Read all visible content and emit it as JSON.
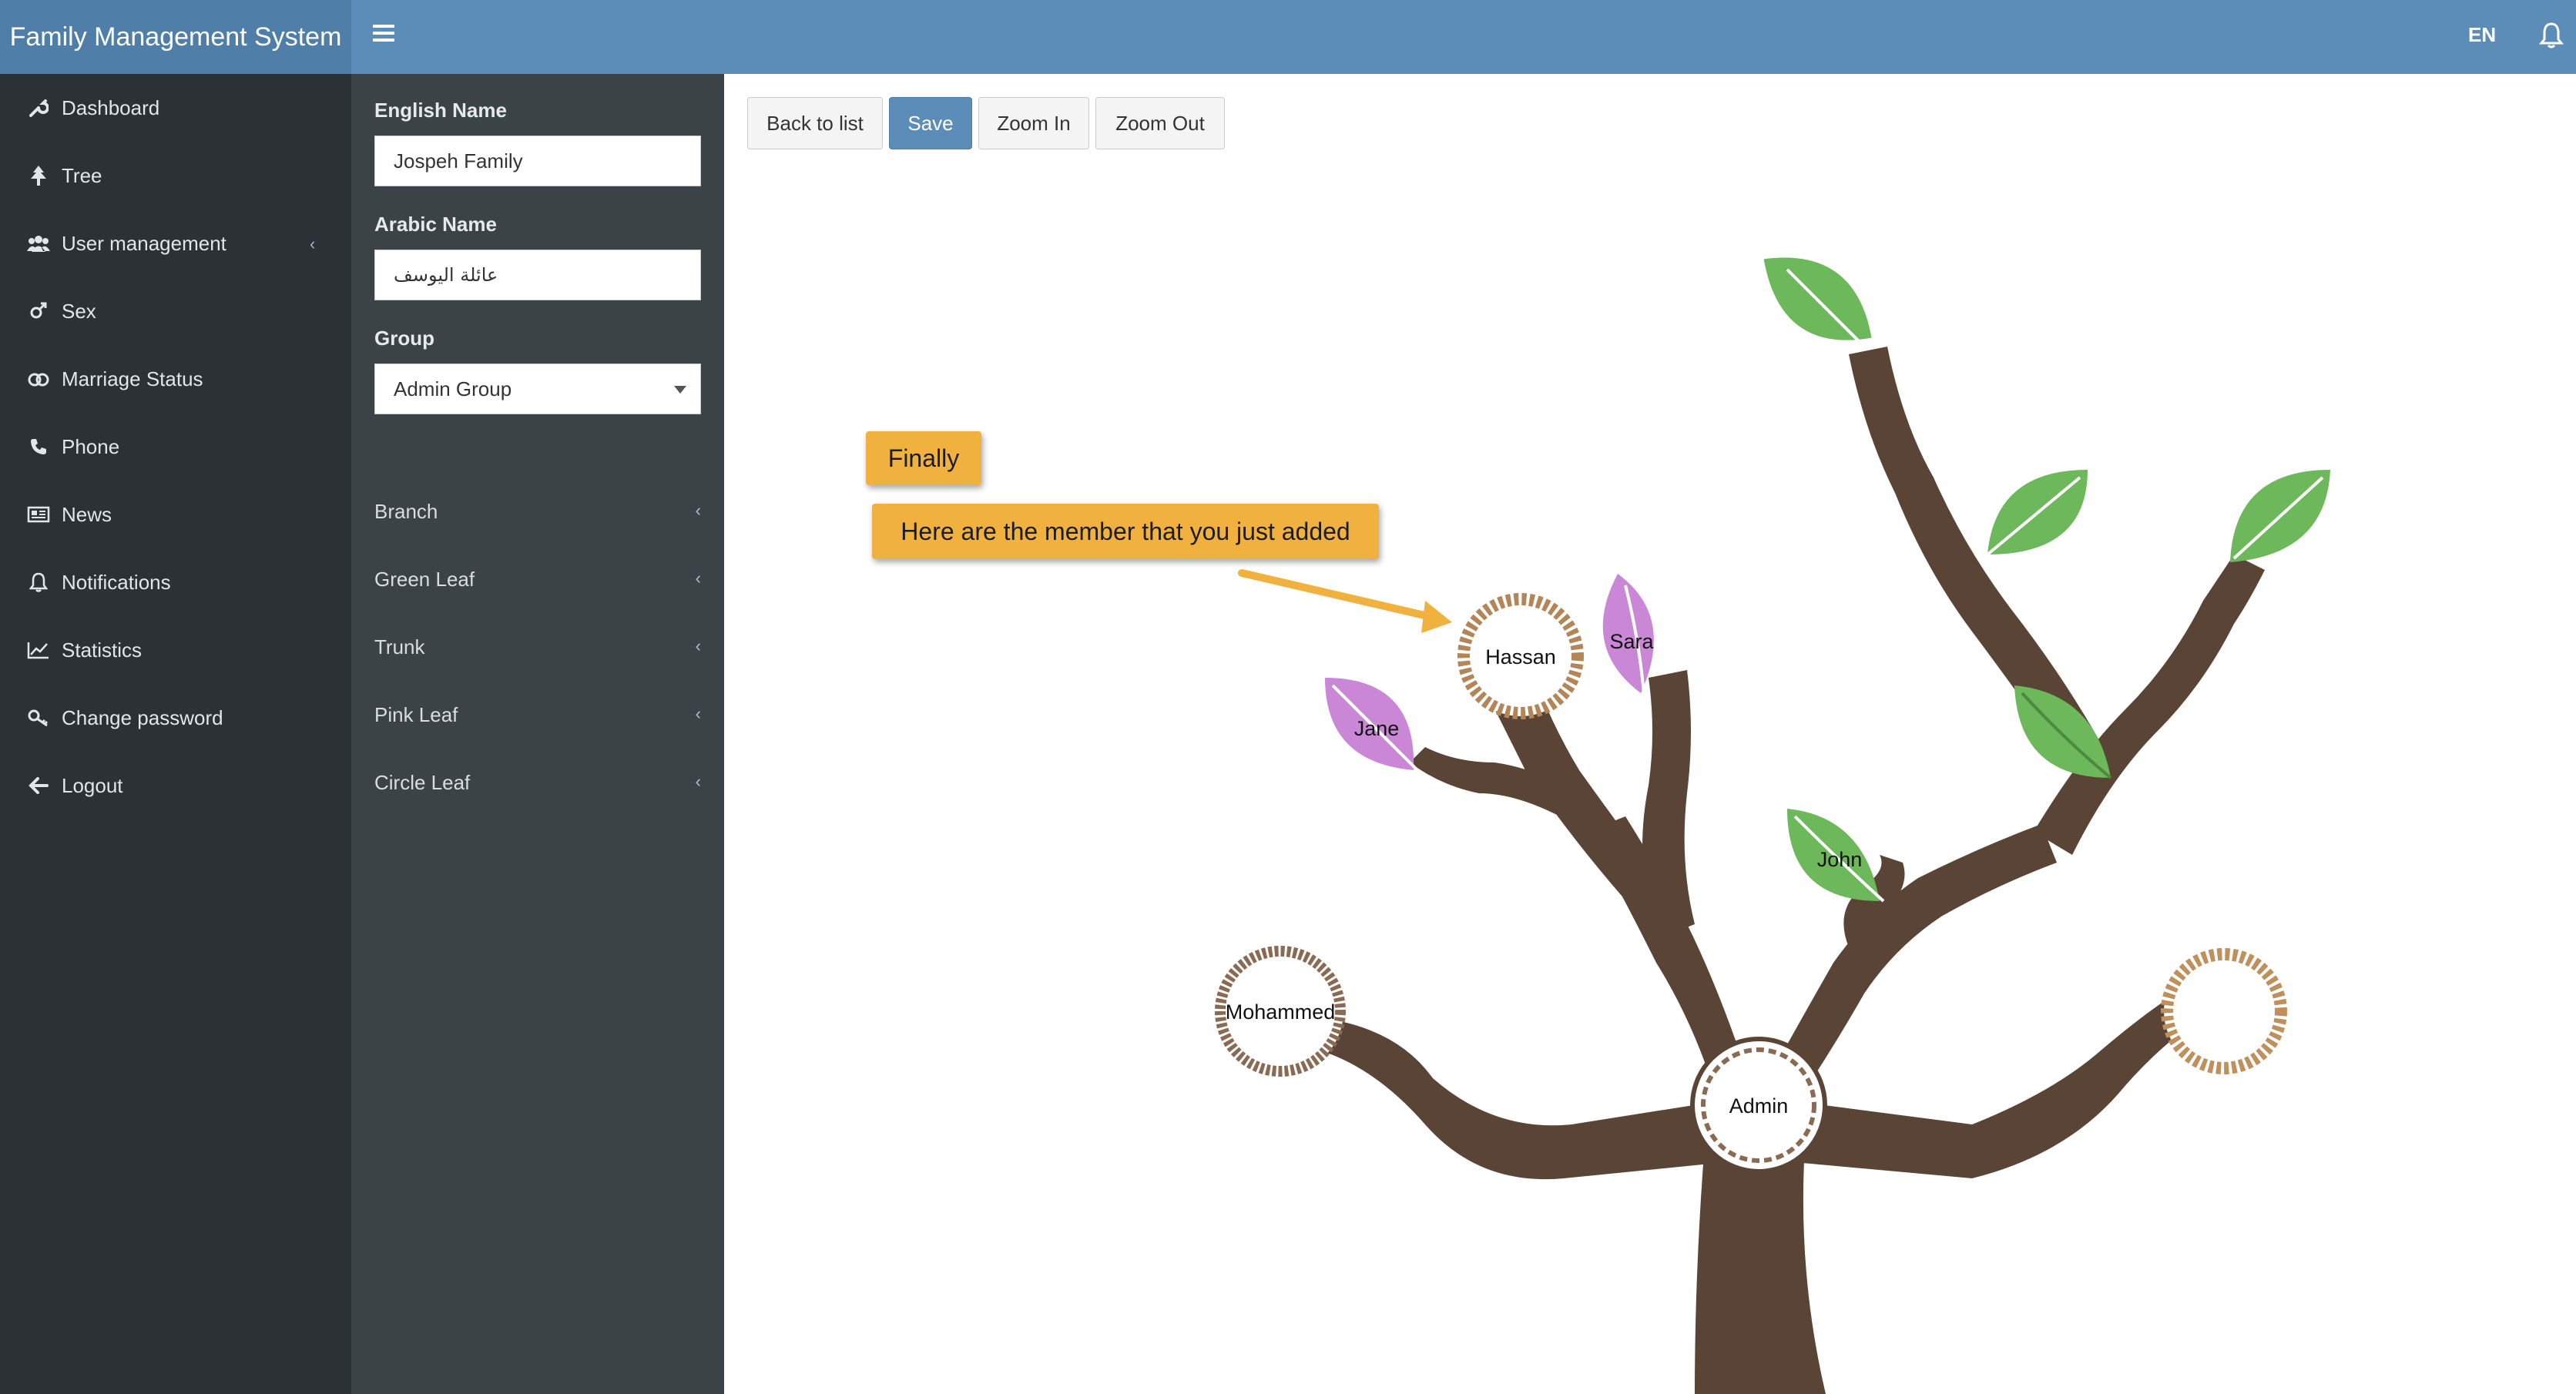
{
  "app": {
    "title": "Family Management System",
    "language": "EN"
  },
  "sidebar": {
    "items": [
      {
        "label": "Dashboard",
        "icon": "wrench-icon"
      },
      {
        "label": "Tree",
        "icon": "tree-icon"
      },
      {
        "label": "User management",
        "icon": "users-icon",
        "has_submenu": true
      },
      {
        "label": "Sex",
        "icon": "gender-icon"
      },
      {
        "label": "Marriage Status",
        "icon": "rings-icon"
      },
      {
        "label": "Phone",
        "icon": "phone-icon"
      },
      {
        "label": "News",
        "icon": "newspaper-icon"
      },
      {
        "label": "Notifications",
        "icon": "bell-icon"
      },
      {
        "label": "Statistics",
        "icon": "chart-icon"
      },
      {
        "label": "Change password",
        "icon": "key-icon"
      },
      {
        "label": "Logout",
        "icon": "arrow-left-icon"
      }
    ]
  },
  "form": {
    "english_name": {
      "label": "English Name",
      "value": "Jospeh Family"
    },
    "arabic_name": {
      "label": "Arabic Name",
      "value": "عائلة اليوسف"
    },
    "group": {
      "label": "Group",
      "value": "Admin Group"
    }
  },
  "categories": [
    {
      "label": "Branch"
    },
    {
      "label": "Green Leaf"
    },
    {
      "label": "Trunk"
    },
    {
      "label": "Pink Leaf"
    },
    {
      "label": "Circle Leaf"
    }
  ],
  "toolbar": {
    "back": "Back to list",
    "save": "Save",
    "zoom_in": "Zoom In",
    "zoom_out": "Zoom Out"
  },
  "callouts": {
    "finally": "Finally",
    "message": "Here are the member that you just added"
  },
  "tree": {
    "members": {
      "hassan": "Hassan",
      "sara": "Sara",
      "jane": "Jane",
      "john": "John",
      "mohammed": "Mohammed",
      "admin": "Admin"
    }
  },
  "colors": {
    "header": "#5b8db8",
    "sidebar": "#2b3134",
    "panel": "#3c4347",
    "primary": "#5b8db8",
    "callout": "#f0b13f",
    "green_leaf": "#6cb85a",
    "pink_leaf": "#c987d6",
    "branch": "#5a4436",
    "ring": "#b48657"
  }
}
